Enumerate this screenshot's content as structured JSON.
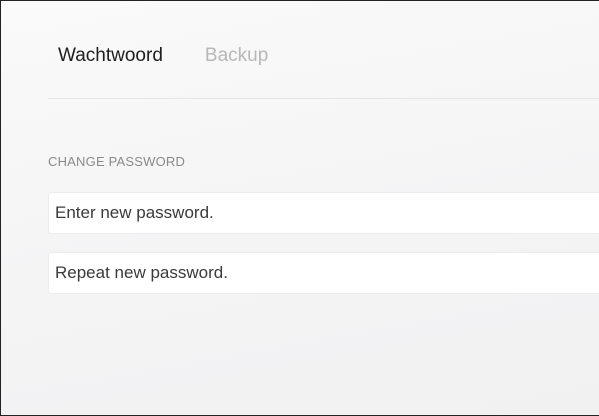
{
  "tabs": [
    {
      "label": "Wachtwoord",
      "active": true
    },
    {
      "label": "Backup",
      "active": false
    }
  ],
  "change_password": {
    "section_label": "CHANGE PASSWORD",
    "new_password": {
      "value": "",
      "placeholder": "Enter new password."
    },
    "repeat_password": {
      "value": "",
      "placeholder": "Repeat new password."
    }
  },
  "colors": {
    "active_tab": "#1e1e1e",
    "inactive_tab": "#b7b7b7",
    "section_label": "#8a8a8c",
    "background": "#f6f6f7"
  }
}
